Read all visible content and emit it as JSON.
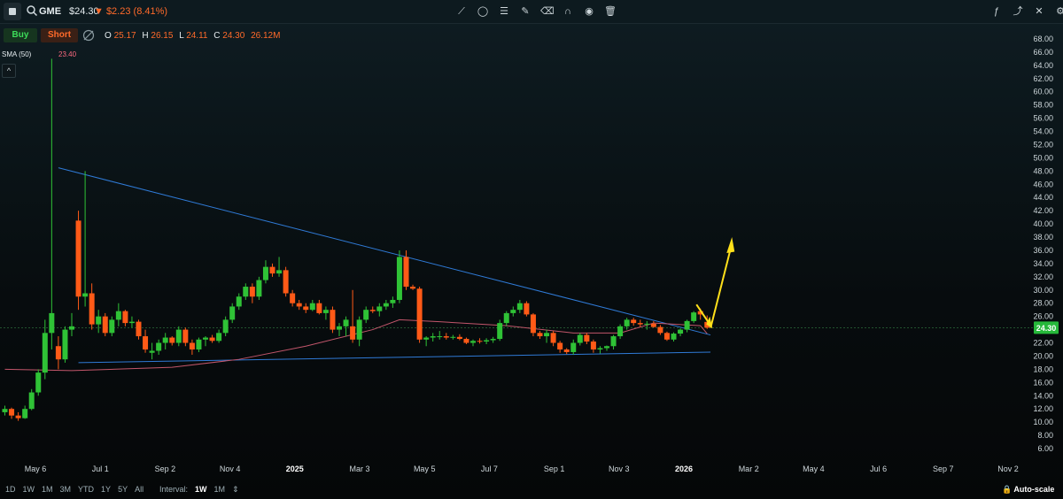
{
  "header": {
    "ticker": "GME",
    "price": "$24.30",
    "change": "▼ $2.23 (8.41%)",
    "buy_label": "Buy",
    "short_label": "Short"
  },
  "ohlc": {
    "open_label": "O",
    "open": "25.17",
    "high_label": "H",
    "high": "26.15",
    "low_label": "L",
    "low": "24.11",
    "close_label": "C",
    "close": "24.30",
    "volume": "26.12M"
  },
  "indicator": {
    "label": "SMA (50)",
    "value": "23.40"
  },
  "bottom": {
    "ranges": [
      "1D",
      "1W",
      "1M",
      "3M",
      "YTD",
      "1Y",
      "5Y",
      "All"
    ],
    "interval_label": "Interval:",
    "interval_options": [
      "1W",
      "1M",
      "⇕"
    ],
    "interval_active": "1W",
    "autoscale_label": "Auto-scale"
  },
  "colors": {
    "up": "#2fc236",
    "down": "#ff5a17",
    "sma": "#c2566b",
    "trendline": "#2f7ad6",
    "arrow": "#ffe01a",
    "price_tag": "#26b83a"
  },
  "chart_data": {
    "type": "candlestick",
    "ylim": [
      6,
      68
    ],
    "y_ticks": [
      "68.00",
      "66.00",
      "64.00",
      "62.00",
      "60.00",
      "58.00",
      "56.00",
      "54.00",
      "52.00",
      "50.00",
      "48.00",
      "46.00",
      "44.00",
      "42.00",
      "40.00",
      "38.00",
      "36.00",
      "34.00",
      "32.00",
      "30.00",
      "28.00",
      "26.00",
      "24.00",
      "22.00",
      "20.00",
      "18.00",
      "16.00",
      "14.00",
      "12.00",
      "10.00",
      "8.00",
      "6.00"
    ],
    "x_ticks": [
      "May 6",
      "Jul 1",
      "Sep 2",
      "Nov 4",
      "2025",
      "Mar 3",
      "May 5",
      "Jul 7",
      "Sep 1",
      "Nov 3",
      "2026",
      "Mar 2",
      "May 4",
      "Jul 6",
      "Sep 7",
      "Nov 2"
    ],
    "x_ticks_bold": [
      "2025",
      "2026"
    ],
    "last_price": "24.30",
    "candles": [
      [
        11.5,
        12.5,
        11,
        12.0
      ],
      [
        12.0,
        12.2,
        10.5,
        11.0
      ],
      [
        11.0,
        11.5,
        10.2,
        10.6
      ],
      [
        10.6,
        12.5,
        10.5,
        12.0
      ],
      [
        12.0,
        15.0,
        11.8,
        14.5
      ],
      [
        14.5,
        18.0,
        14.0,
        17.5
      ],
      [
        17.5,
        25.5,
        16.5,
        23.5
      ],
      [
        23.5,
        65,
        21,
        26.5
      ],
      [
        21.5,
        23,
        18,
        19.5
      ],
      [
        19.5,
        24.5,
        19,
        24.0
      ],
      [
        24.0,
        26.5,
        23,
        24.5
      ],
      [
        40.5,
        42,
        27,
        29.0
      ],
      [
        29.0,
        48,
        27.5,
        29.5
      ],
      [
        29.5,
        31,
        24,
        24.8
      ],
      [
        24.8,
        27,
        23.5,
        26.0
      ],
      [
        26.0,
        26.5,
        23,
        23.5
      ],
      [
        23.5,
        26,
        23,
        25.5
      ],
      [
        25.5,
        28,
        24.5,
        26.8
      ],
      [
        26.8,
        27,
        24.5,
        25.0
      ],
      [
        25.0,
        26,
        24.3,
        25.2
      ],
      [
        25.2,
        25.5,
        22.5,
        23.0
      ],
      [
        23.0,
        24,
        20.5,
        21.0
      ],
      [
        20.5,
        22,
        19.5,
        20.8
      ],
      [
        20.8,
        22.5,
        20.2,
        22.0
      ],
      [
        22.0,
        23.5,
        21,
        22.8
      ],
      [
        22.8,
        23,
        21.6,
        22.0
      ],
      [
        22.0,
        24.5,
        21.5,
        24.0
      ],
      [
        24.0,
        24.3,
        21.5,
        22.0
      ],
      [
        22.0,
        22.5,
        20.2,
        21.0
      ],
      [
        21.0,
        22.8,
        20.6,
        22.5
      ],
      [
        22.5,
        23,
        21.5,
        22.8
      ],
      [
        22.8,
        23.2,
        22,
        22.3
      ],
      [
        22.3,
        24,
        22,
        23.5
      ],
      [
        23.5,
        26,
        23,
        25.5
      ],
      [
        25.5,
        28,
        25,
        27.5
      ],
      [
        27.5,
        29.5,
        27,
        29.0
      ],
      [
        29.0,
        31,
        28.5,
        30.5
      ],
      [
        30.5,
        31,
        28,
        29.0
      ],
      [
        29.0,
        32,
        28.5,
        31.5
      ],
      [
        31.5,
        34.5,
        31,
        33.5
      ],
      [
        33.5,
        34,
        32,
        32.5
      ],
      [
        32.5,
        35,
        32,
        33.0
      ],
      [
        33.0,
        33.5,
        29,
        29.5
      ],
      [
        29.5,
        30,
        27.5,
        28.0
      ],
      [
        28.0,
        28.5,
        27,
        27.5
      ],
      [
        27.5,
        28,
        26.5,
        27.0
      ],
      [
        27.0,
        28.5,
        26.8,
        28.0
      ],
      [
        28.0,
        28.5,
        26.3,
        26.5
      ],
      [
        26.5,
        27.5,
        25.5,
        27.0
      ],
      [
        27.0,
        27.5,
        23.5,
        24.0
      ],
      [
        24.0,
        25,
        23,
        24.5
      ],
      [
        24.5,
        26,
        23,
        25.5
      ],
      [
        24.5,
        30,
        22,
        22.5
      ],
      [
        22.5,
        26,
        21.5,
        25.5
      ],
      [
        25.5,
        27.5,
        25,
        27.0
      ],
      [
        27.0,
        27.5,
        26.5,
        26.8
      ],
      [
        26.8,
        28,
        26,
        27.5
      ],
      [
        27.5,
        28.5,
        27,
        28.0
      ],
      [
        28.0,
        29,
        27.3,
        28.5
      ],
      [
        28.5,
        36,
        28,
        35.0
      ],
      [
        35.0,
        36,
        30,
        30.5
      ],
      [
        30.5,
        30.8,
        30,
        30.2
      ],
      [
        30.2,
        30.5,
        22,
        22.5
      ],
      [
        22.5,
        23,
        21.5,
        22.8
      ],
      [
        22.8,
        23.5,
        22.2,
        23.0
      ],
      [
        23.0,
        23.8,
        22.5,
        23.0
      ],
      [
        23.0,
        23.5,
        22.5,
        22.8
      ],
      [
        22.8,
        23.2,
        22.5,
        22.9
      ],
      [
        22.9,
        23.3,
        22.4,
        22.6
      ],
      [
        22.6,
        22.8,
        21.8,
        22.0
      ],
      [
        22.0,
        22.5,
        21.5,
        22.3
      ],
      [
        22.3,
        22.7,
        21.9,
        22.2
      ],
      [
        22.2,
        22.7,
        21.8,
        22.4
      ],
      [
        22.4,
        22.9,
        22,
        22.6
      ],
      [
        22.6,
        25.5,
        22.3,
        25.0
      ],
      [
        25.0,
        26.8,
        24.5,
        26.5
      ],
      [
        26.5,
        27.5,
        26,
        27.0
      ],
      [
        27.0,
        28.5,
        26.5,
        28.0
      ],
      [
        28.0,
        28.3,
        26,
        26.3
      ],
      [
        26.3,
        26.5,
        23,
        23.5
      ],
      [
        23.5,
        23.8,
        22.6,
        23.0
      ],
      [
        23.0,
        24,
        22,
        23.5
      ],
      [
        23.5,
        23.8,
        21.5,
        22.0
      ],
      [
        22.0,
        22.3,
        20.5,
        21.0
      ],
      [
        21.0,
        21.2,
        20.3,
        20.6
      ],
      [
        20.6,
        22.5,
        20.2,
        22.0
      ],
      [
        22.0,
        23.5,
        21.6,
        23.2
      ],
      [
        23.2,
        23.5,
        21.8,
        22.2
      ],
      [
        22.2,
        22.5,
        20.5,
        21.0
      ],
      [
        21.0,
        21.5,
        20.4,
        21.2
      ],
      [
        21.2,
        21.6,
        20.8,
        21.5
      ],
      [
        21.5,
        23.2,
        21,
        23.0
      ],
      [
        23.0,
        24.8,
        22.6,
        24.5
      ],
      [
        24.5,
        25.8,
        24,
        25.5
      ],
      [
        25.5,
        25.8,
        24.6,
        25.0
      ],
      [
        25.0,
        25.5,
        24.4,
        24.8
      ],
      [
        24.8,
        25.3,
        24,
        24.9
      ],
      [
        24.9,
        25.3,
        24.3,
        24.4
      ],
      [
        24.4,
        24.7,
        23.2,
        23.5
      ],
      [
        23.5,
        23.7,
        22.3,
        22.5
      ],
      [
        22.5,
        23.6,
        22.2,
        23.4
      ],
      [
        23.4,
        24.2,
        23,
        24.0
      ],
      [
        24.0,
        25.5,
        23.6,
        25.3
      ],
      [
        25.3,
        26.8,
        25,
        26.6
      ],
      [
        26.8,
        27.2,
        25.5,
        26.3
      ],
      [
        25.17,
        26.15,
        24.11,
        24.3
      ]
    ],
    "sma_50": [
      [
        0,
        18.0
      ],
      [
        10,
        17.8
      ],
      [
        25,
        18.3
      ],
      [
        35,
        19.5
      ],
      [
        45,
        21.5
      ],
      [
        55,
        24.0
      ],
      [
        59,
        25.5
      ],
      [
        65,
        25.2
      ],
      [
        75,
        24.6
      ],
      [
        85,
        23.5
      ],
      [
        92,
        23.5
      ],
      [
        97,
        25.0
      ],
      [
        104,
        24.6
      ],
      [
        105,
        23.4
      ]
    ],
    "upper_trendline": [
      [
        48.5,
        8
      ],
      [
        23.2,
        105.5
      ]
    ],
    "lower_trendline": [
      [
        19,
        11
      ],
      [
        20.6,
        105.5
      ]
    ]
  }
}
